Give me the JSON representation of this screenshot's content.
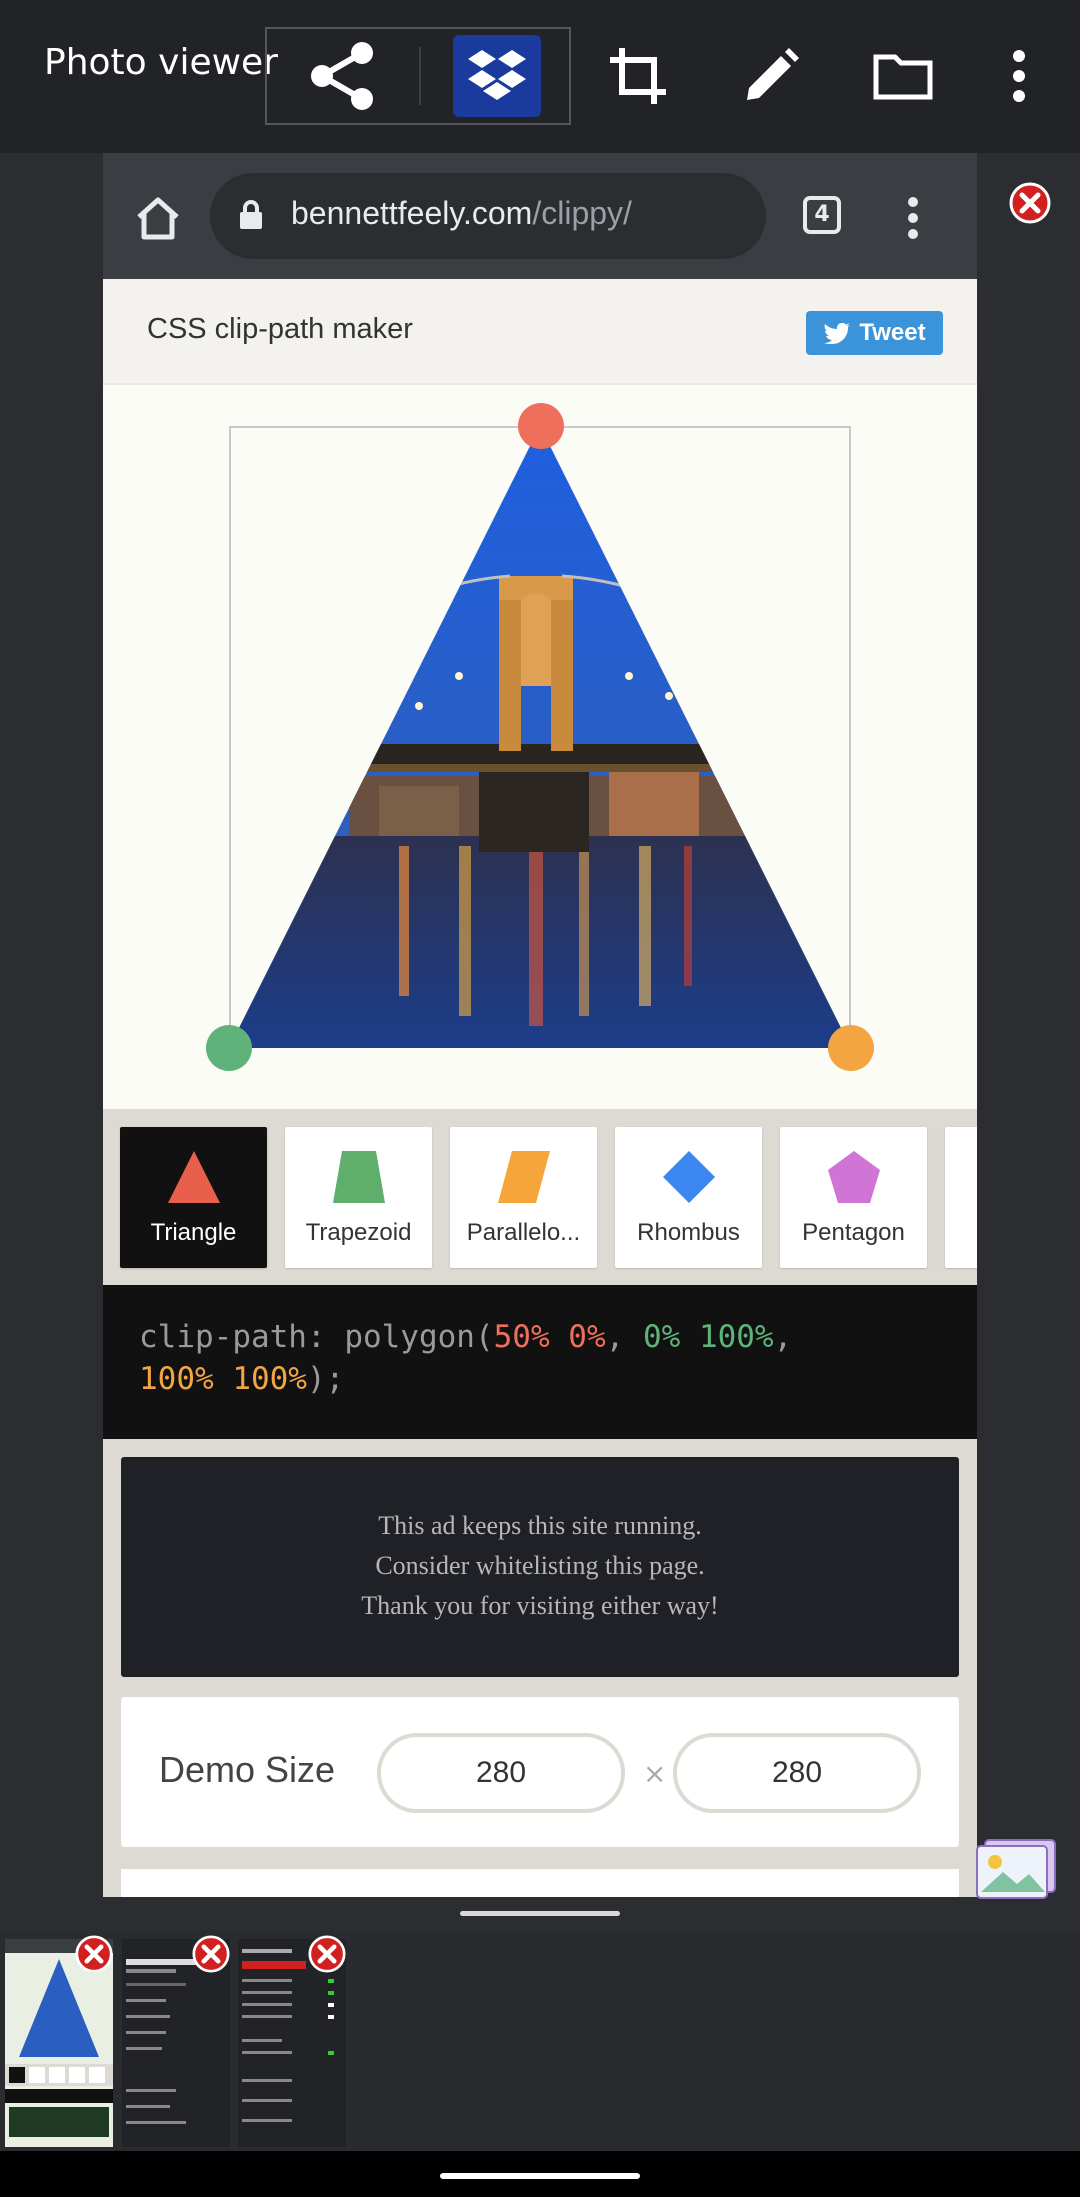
{
  "app": {
    "title": "Photo viewer",
    "toolbar_icons": [
      "share-icon",
      "dropbox-icon",
      "crop-icon",
      "edit-icon",
      "folder-icon",
      "more-vertical-icon"
    ]
  },
  "browser": {
    "url_host": "bennettfeely.com",
    "url_path": "/clippy/",
    "tab_count": "4"
  },
  "site": {
    "title": "CSS clip-path maker",
    "tweet_label": "Tweet"
  },
  "shapes": [
    {
      "label": "Triangle",
      "color": "#e8604c",
      "active": true
    },
    {
      "label": "Trapezoid",
      "color": "#5fae6b",
      "active": false
    },
    {
      "label": "Parallelo...",
      "color": "#f5a53a",
      "active": false
    },
    {
      "label": "Rhombus",
      "color": "#3b86f0",
      "active": false
    },
    {
      "label": "Pentagon",
      "color": "#d074d5",
      "active": false
    }
  ],
  "code": {
    "prop": "clip-path:",
    "func": "polygon(",
    "p1": "50% 0%",
    "p2": "0% 100%",
    "p3": "100% 100%",
    "close": ");",
    "comma1": ",",
    "comma2": ","
  },
  "ad": {
    "line1": "This ad keeps this site running.",
    "line2": "Consider whitelisting this page.",
    "line3": "Thank you for visiting either way!"
  },
  "demo_size": {
    "label": "Demo Size",
    "width": "280",
    "times": "×",
    "height": "280"
  },
  "colors": {
    "handle_top": "#ee6f5c",
    "handle_left": "#5fb37a",
    "handle_right": "#f2a541",
    "dropbox_bg": "#1a3a9e"
  }
}
